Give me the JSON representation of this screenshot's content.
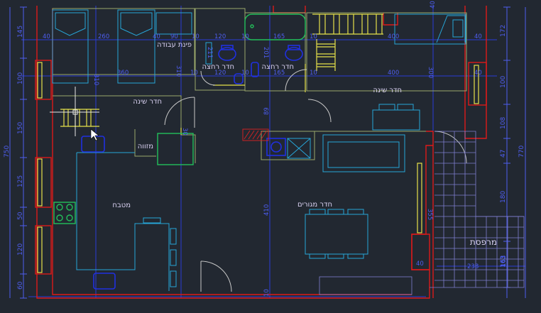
{
  "colors": {
    "background": "#222831",
    "wall": "#dd1a1a",
    "grid": "#2a3bd6",
    "window": "#e6e14a",
    "room_outline": "#9aa86a",
    "furniture": "#27a6d8",
    "fixture": "#2030e0",
    "door": "#c8c8c8",
    "balcony": "#7f7fd0",
    "green": "#22c05a",
    "text_blue": "#4e5ef0",
    "text_label": "#d8d0f0",
    "hatch": "#cc2222"
  },
  "left_dims": [
    "145",
    "100",
    "150",
    "125",
    "50",
    "120",
    "60"
  ],
  "left_total": "750",
  "right_dims": [
    "172",
    "100",
    "108",
    "47",
    "180",
    "163"
  ],
  "right_total": "770",
  "top_dims": {
    "top_40_left": "40",
    "top_260": "260",
    "top_40_mid": "40",
    "top_90": "90",
    "top_10a": "10",
    "top_120": "120",
    "top_10b": "10",
    "top_165": "165",
    "top_10c": "10",
    "top_400": "400",
    "top_40_right": "40",
    "top_40_tiny": "40"
  },
  "mid_dims": {
    "mid_310a": "310",
    "mid_360": "360",
    "mid_310b": "310",
    "mid_10a": "10",
    "mid_120": "120",
    "mid_10b": "10",
    "mid_165": "165",
    "mid_10c": "10",
    "mid_400": "400",
    "mid_300": "300",
    "mid_40": "40",
    "mid_211": "211",
    "mid_201": "201",
    "mid_89": "89",
    "mid_410": "410",
    "mid_355": "355",
    "mid_10d": "10",
    "mid_30": "30"
  },
  "balcony_dims": {
    "bal_40": "40",
    "bal_238": "238",
    "bal_163": "163"
  },
  "rooms": {
    "work_area": "פינת עבודה",
    "bedroom_left": "חדר שינה",
    "bath_left": "חדר רחצה",
    "bath_right": "חדר רחצה",
    "bedroom_right": "חדר שינה",
    "pantry": "מזווה",
    "kitchen": "מטבח",
    "living": "חדר מגורים",
    "balcony": "מרפסת"
  }
}
